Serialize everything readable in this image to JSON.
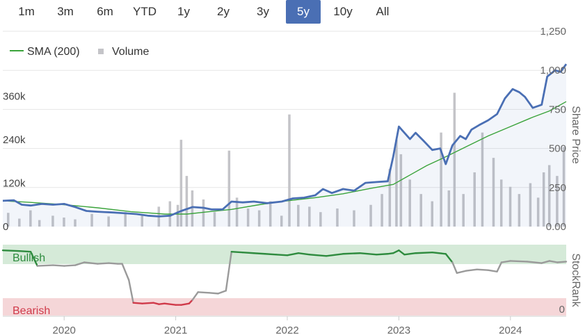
{
  "range_selector": {
    "buttons": [
      "1m",
      "3m",
      "6m",
      "YTD",
      "1y",
      "2y",
      "3y",
      "5y",
      "10y",
      "All"
    ],
    "active": "5y"
  },
  "legend": {
    "sma_label": "SMA (200)",
    "volume_label": "Volume"
  },
  "colors": {
    "price": "#4a6fb4",
    "sma": "#3aa33a",
    "volume": "#c4c4c8",
    "bullish_zone": "#d5ead8",
    "bearish_zone": "#f5d6d8",
    "bullish_line": "#2e8b3e",
    "bearish_line": "#d03a4a",
    "neutral_line": "#9a9a9a",
    "bullish_text": "#2e8b3e",
    "bearish_text": "#d03a4a",
    "active_button": "#4a6fb4"
  },
  "chart_data": {
    "type": "line",
    "x_range": [
      2019.45,
      2024.5
    ],
    "x_ticks": [
      {
        "value": 2020,
        "label": "2020"
      },
      {
        "value": 2021,
        "label": "2021"
      },
      {
        "value": 2022,
        "label": "2022"
      },
      {
        "value": 2023,
        "label": "2023"
      },
      {
        "value": 2024,
        "label": "2024"
      }
    ],
    "price_axis": {
      "title": "Share Price",
      "ylim": [
        0,
        1250
      ],
      "ticks": [
        {
          "value": 0,
          "label": "0.00"
        },
        {
          "value": 250,
          "label": "250"
        },
        {
          "value": 500,
          "label": "500"
        },
        {
          "value": 750,
          "label": "750"
        },
        {
          "value": 1000,
          "label": "1,000"
        },
        {
          "value": 1250,
          "label": "1,250"
        }
      ]
    },
    "volume_axis": {
      "ylim": [
        0,
        540000
      ],
      "ticks": [
        {
          "value": 0,
          "label": "0"
        },
        {
          "value": 120000,
          "label": "120k"
        },
        {
          "value": 240000,
          "label": "240k"
        },
        {
          "value": 360000,
          "label": "360k"
        }
      ]
    },
    "series": [
      {
        "name": "Price",
        "values": [
          [
            2019.45,
            165
          ],
          [
            2019.55,
            168
          ],
          [
            2019.62,
            140
          ],
          [
            2019.7,
            135
          ],
          [
            2019.8,
            145
          ],
          [
            2019.9,
            140
          ],
          [
            2020.0,
            145
          ],
          [
            2020.1,
            125
          ],
          [
            2020.2,
            100
          ],
          [
            2020.3,
            95
          ],
          [
            2020.45,
            90
          ],
          [
            2020.55,
            85
          ],
          [
            2020.65,
            80
          ],
          [
            2020.75,
            70
          ],
          [
            2020.85,
            65
          ],
          [
            2020.95,
            70
          ],
          [
            2021.05,
            100
          ],
          [
            2021.15,
            125
          ],
          [
            2021.25,
            120
          ],
          [
            2021.32,
            110
          ],
          [
            2021.42,
            110
          ],
          [
            2021.5,
            160
          ],
          [
            2021.6,
            155
          ],
          [
            2021.7,
            160
          ],
          [
            2021.82,
            150
          ],
          [
            2021.95,
            160
          ],
          [
            2022.05,
            180
          ],
          [
            2022.15,
            185
          ],
          [
            2022.25,
            200
          ],
          [
            2022.32,
            240
          ],
          [
            2022.4,
            215
          ],
          [
            2022.5,
            240
          ],
          [
            2022.6,
            230
          ],
          [
            2022.7,
            280
          ],
          [
            2022.8,
            285
          ],
          [
            2022.9,
            290
          ],
          [
            2022.95,
            450
          ],
          [
            2023.0,
            640
          ],
          [
            2023.05,
            600
          ],
          [
            2023.1,
            560
          ],
          [
            2023.15,
            600
          ],
          [
            2023.22,
            550
          ],
          [
            2023.3,
            490
          ],
          [
            2023.37,
            500
          ],
          [
            2023.42,
            400
          ],
          [
            2023.48,
            520
          ],
          [
            2023.55,
            580
          ],
          [
            2023.6,
            560
          ],
          [
            2023.65,
            620
          ],
          [
            2023.72,
            650
          ],
          [
            2023.8,
            680
          ],
          [
            2023.88,
            720
          ],
          [
            2023.95,
            820
          ],
          [
            2024.02,
            880
          ],
          [
            2024.08,
            860
          ],
          [
            2024.13,
            830
          ],
          [
            2024.2,
            760
          ],
          [
            2024.28,
            780
          ],
          [
            2024.33,
            960
          ],
          [
            2024.4,
            1000
          ],
          [
            2024.45,
            990
          ],
          [
            2024.5,
            1040
          ]
        ]
      },
      {
        "name": "SMA (200)",
        "values": [
          [
            2019.45,
            165
          ],
          [
            2019.7,
            155
          ],
          [
            2020.0,
            140
          ],
          [
            2020.3,
            120
          ],
          [
            2020.6,
            95
          ],
          [
            2020.9,
            80
          ],
          [
            2021.1,
            80
          ],
          [
            2021.3,
            95
          ],
          [
            2021.5,
            110
          ],
          [
            2021.75,
            140
          ],
          [
            2022.0,
            165
          ],
          [
            2022.25,
            185
          ],
          [
            2022.5,
            210
          ],
          [
            2022.75,
            245
          ],
          [
            2022.95,
            270
          ],
          [
            2023.1,
            330
          ],
          [
            2023.25,
            390
          ],
          [
            2023.4,
            440
          ],
          [
            2023.6,
            510
          ],
          [
            2023.8,
            580
          ],
          [
            2024.0,
            640
          ],
          [
            2024.2,
            700
          ],
          [
            2024.35,
            740
          ],
          [
            2024.5,
            800
          ]
        ]
      },
      {
        "name": "Volume",
        "values": [
          [
            2019.5,
            38000
          ],
          [
            2019.6,
            22000
          ],
          [
            2019.7,
            45000
          ],
          [
            2019.78,
            18000
          ],
          [
            2019.9,
            30000
          ],
          [
            2020.0,
            25000
          ],
          [
            2020.1,
            20000
          ],
          [
            2020.25,
            35000
          ],
          [
            2020.4,
            28000
          ],
          [
            2020.55,
            40000
          ],
          [
            2020.7,
            30000
          ],
          [
            2020.85,
            55000
          ],
          [
            2020.95,
            70000
          ],
          [
            2021.02,
            60000
          ],
          [
            2021.05,
            240000
          ],
          [
            2021.1,
            140000
          ],
          [
            2021.15,
            100000
          ],
          [
            2021.25,
            75000
          ],
          [
            2021.35,
            40000
          ],
          [
            2021.48,
            210000
          ],
          [
            2021.55,
            80000
          ],
          [
            2021.65,
            50000
          ],
          [
            2021.75,
            45000
          ],
          [
            2021.85,
            70000
          ],
          [
            2021.95,
            30000
          ],
          [
            2022.02,
            310000
          ],
          [
            2022.1,
            60000
          ],
          [
            2022.2,
            55000
          ],
          [
            2022.3,
            40000
          ],
          [
            2022.45,
            50000
          ],
          [
            2022.6,
            45000
          ],
          [
            2022.75,
            60000
          ],
          [
            2022.85,
            90000
          ],
          [
            2022.92,
            160000
          ],
          [
            2022.98,
            240000
          ],
          [
            2023.02,
            200000
          ],
          [
            2023.1,
            130000
          ],
          [
            2023.2,
            90000
          ],
          [
            2023.3,
            70000
          ],
          [
            2023.38,
            260000
          ],
          [
            2023.45,
            100000
          ],
          [
            2023.5,
            370000
          ],
          [
            2023.58,
            90000
          ],
          [
            2023.68,
            150000
          ],
          [
            2023.75,
            260000
          ],
          [
            2023.85,
            190000
          ],
          [
            2023.92,
            130000
          ],
          [
            2024.0,
            110000
          ],
          [
            2024.08,
            90000
          ],
          [
            2024.18,
            120000
          ],
          [
            2024.25,
            80000
          ],
          [
            2024.3,
            150000
          ],
          [
            2024.35,
            170000
          ],
          [
            2024.42,
            140000
          ],
          [
            2024.48,
            220000
          ]
        ]
      }
    ],
    "stockrank": {
      "title": "StockRank",
      "ylim": [
        0,
        100
      ],
      "ticks": [
        {
          "value": 0,
          "label": "0"
        }
      ],
      "zones": [
        {
          "label": "Bullish",
          "from": 80,
          "to": 100
        },
        {
          "label": "Bearish",
          "from": 0,
          "to": 20
        }
      ],
      "values": [
        [
          2019.45,
          92
        ],
        [
          2019.6,
          91
        ],
        [
          2019.7,
          90
        ],
        [
          2019.76,
          70
        ],
        [
          2019.9,
          71
        ],
        [
          2020.0,
          70
        ],
        [
          2020.1,
          71
        ],
        [
          2020.18,
          75
        ],
        [
          2020.3,
          73
        ],
        [
          2020.4,
          74
        ],
        [
          2020.48,
          73
        ],
        [
          2020.52,
          73
        ],
        [
          2020.58,
          50
        ],
        [
          2020.62,
          18
        ],
        [
          2020.7,
          17
        ],
        [
          2020.8,
          18
        ],
        [
          2020.85,
          16
        ],
        [
          2020.9,
          17
        ],
        [
          2021.0,
          15
        ],
        [
          2021.05,
          15
        ],
        [
          2021.12,
          17
        ],
        [
          2021.15,
          22
        ],
        [
          2021.2,
          33
        ],
        [
          2021.3,
          32
        ],
        [
          2021.38,
          31
        ],
        [
          2021.45,
          35
        ],
        [
          2021.5,
          90
        ],
        [
          2021.6,
          89
        ],
        [
          2021.7,
          88
        ],
        [
          2021.8,
          87
        ],
        [
          2021.9,
          86
        ],
        [
          2022.0,
          85
        ],
        [
          2022.1,
          88
        ],
        [
          2022.2,
          86
        ],
        [
          2022.35,
          84
        ],
        [
          2022.5,
          87
        ],
        [
          2022.65,
          88
        ],
        [
          2022.8,
          86
        ],
        [
          2022.9,
          87
        ],
        [
          2022.95,
          88
        ],
        [
          2023.0,
          92
        ],
        [
          2023.05,
          86
        ],
        [
          2023.15,
          88
        ],
        [
          2023.3,
          89
        ],
        [
          2023.42,
          87
        ],
        [
          2023.48,
          75
        ],
        [
          2023.52,
          60
        ],
        [
          2023.6,
          63
        ],
        [
          2023.7,
          65
        ],
        [
          2023.8,
          64
        ],
        [
          2023.88,
          62
        ],
        [
          2023.92,
          75
        ],
        [
          2024.0,
          77
        ],
        [
          2024.15,
          76
        ],
        [
          2024.28,
          74
        ],
        [
          2024.35,
          77
        ],
        [
          2024.42,
          75
        ],
        [
          2024.5,
          76
        ]
      ]
    }
  }
}
